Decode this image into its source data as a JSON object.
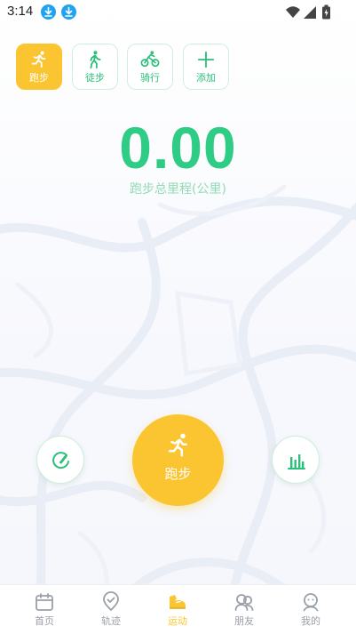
{
  "status_bar": {
    "time": "3:14",
    "icons": [
      "download-icon",
      "download-icon",
      "wifi-icon",
      "signal-icon",
      "battery-icon"
    ]
  },
  "mode_tabs": [
    {
      "label": "跑步",
      "icon": "running-icon",
      "active": true
    },
    {
      "label": "徒步",
      "icon": "walking-icon",
      "active": false
    },
    {
      "label": "骑行",
      "icon": "bicycle-icon",
      "active": false
    },
    {
      "label": "添加",
      "icon": "plus-icon",
      "active": false
    }
  ],
  "distance": {
    "value": "0.00",
    "label": "跑步总里程(公里)"
  },
  "actions": {
    "left_icon": "compass-icon",
    "start_label": "跑步",
    "start_icon": "running-icon",
    "right_icon": "bar-chart-icon"
  },
  "bottom_nav": [
    {
      "label": "首页",
      "icon": "calendar-icon",
      "active": false
    },
    {
      "label": "轨迹",
      "icon": "map-pin-icon",
      "active": false
    },
    {
      "label": "运动",
      "icon": "shoe-icon",
      "active": true
    },
    {
      "label": "朋友",
      "icon": "friends-icon",
      "active": false
    },
    {
      "label": "我的",
      "icon": "profile-icon",
      "active": false
    }
  ],
  "colors": {
    "accent": "#fbc531",
    "green": "#2ecc84",
    "green_light": "#8fdcb3",
    "nav_inactive": "#9aa0a8",
    "status_icon_blue": "#1fa3f0"
  }
}
